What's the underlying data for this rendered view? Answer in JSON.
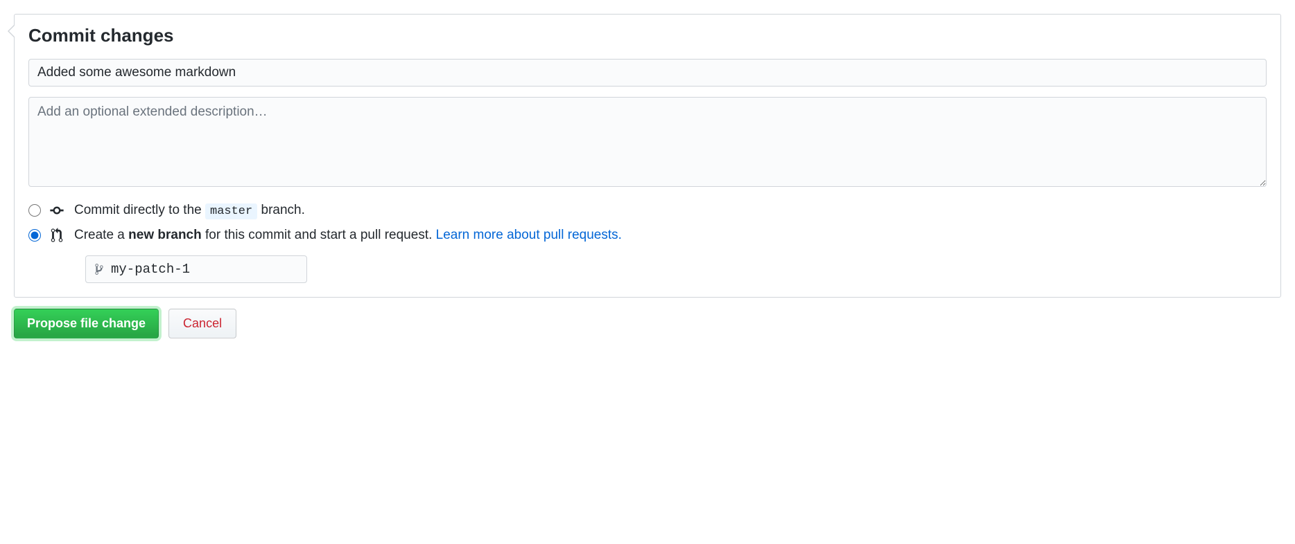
{
  "heading": "Commit changes",
  "summary": {
    "value": "Added some awesome markdown"
  },
  "description": {
    "value": "",
    "placeholder": "Add an optional extended description…"
  },
  "options": {
    "direct": {
      "prefix": "Commit directly to the ",
      "branch": "master",
      "suffix": " branch.",
      "selected": false
    },
    "newbranch": {
      "prefix": "Create a ",
      "bold": "new branch",
      "suffix": " for this commit and start a pull request. ",
      "link": "Learn more about pull requests.",
      "selected": true
    }
  },
  "branch_input": {
    "value": "my-patch-1"
  },
  "buttons": {
    "propose": "Propose file change",
    "cancel": "Cancel"
  }
}
